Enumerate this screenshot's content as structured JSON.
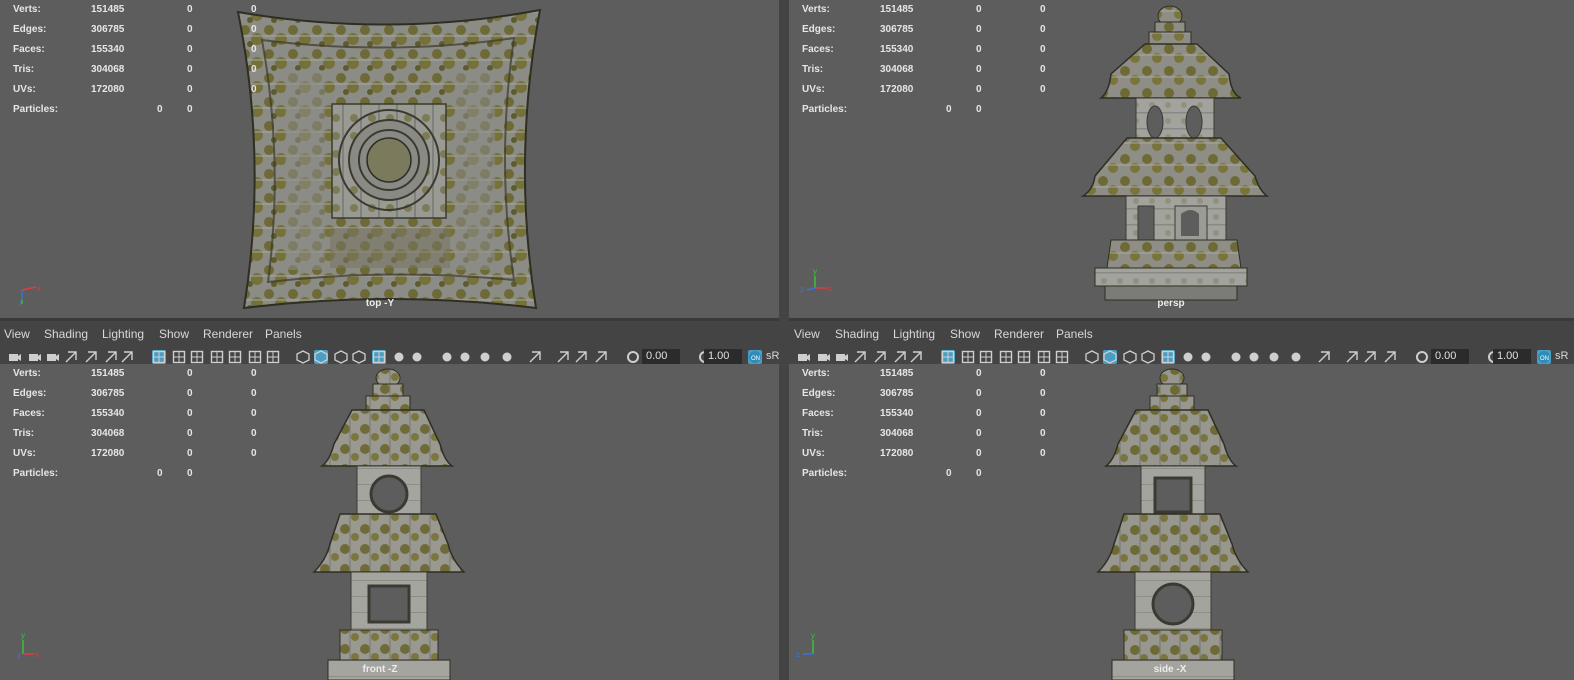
{
  "colors": {
    "viewport_bg": "#5d5d5d",
    "panel_bg": "#444444",
    "hud_text": "#e6e6e6",
    "active_icon": "#4a9ec4",
    "moss": "#7a7436",
    "stone": "#8e8e8a"
  },
  "viewports": {
    "top": {
      "camera": "top -Y",
      "stats": [
        {
          "label": "Verts:",
          "v1": "151485",
          "v2": "0",
          "v3": "0"
        },
        {
          "label": "Edges:",
          "v1": "306785",
          "v2": "0",
          "v3": "0"
        },
        {
          "label": "Faces:",
          "v1": "155340",
          "v2": "0",
          "v3": "0"
        },
        {
          "label": "Tris:",
          "v1": "304068",
          "v2": "0",
          "v3": "0"
        },
        {
          "label": "UVs:",
          "v1": "172080",
          "v2": "0",
          "v3": "0"
        },
        {
          "label": "Particles:",
          "v1": "0",
          "v2": "0"
        }
      ],
      "axis_labels": [
        "y",
        "z",
        "x"
      ]
    },
    "persp": {
      "camera": "persp",
      "stats": [
        {
          "label": "Verts:",
          "v1": "151485",
          "v2": "0",
          "v3": "0"
        },
        {
          "label": "Edges:",
          "v1": "306785",
          "v2": "0",
          "v3": "0"
        },
        {
          "label": "Faces:",
          "v1": "155340",
          "v2": "0",
          "v3": "0"
        },
        {
          "label": "Tris:",
          "v1": "304068",
          "v2": "0",
          "v3": "0"
        },
        {
          "label": "UVs:",
          "v1": "172080",
          "v2": "0",
          "v3": "0"
        },
        {
          "label": "Particles:",
          "v1": "0",
          "v2": "0"
        }
      ],
      "axis_labels": [
        "y",
        "z",
        "x"
      ]
    },
    "front": {
      "camera": "front -Z",
      "stats": [
        {
          "label": "Verts:",
          "v1": "151485",
          "v2": "0",
          "v3": "0"
        },
        {
          "label": "Edges:",
          "v1": "306785",
          "v2": "0",
          "v3": "0"
        },
        {
          "label": "Faces:",
          "v1": "155340",
          "v2": "0",
          "v3": "0"
        },
        {
          "label": "Tris:",
          "v1": "304068",
          "v2": "0",
          "v3": "0"
        },
        {
          "label": "UVs:",
          "v1": "172080",
          "v2": "0",
          "v3": "0"
        },
        {
          "label": "Particles:",
          "v1": "0",
          "v2": "0"
        }
      ],
      "axis_labels": [
        "y",
        "z",
        "x"
      ]
    },
    "side": {
      "camera": "side -X",
      "stats": [
        {
          "label": "Verts:",
          "v1": "151485",
          "v2": "0",
          "v3": "0"
        },
        {
          "label": "Edges:",
          "v1": "306785",
          "v2": "0",
          "v3": "0"
        },
        {
          "label": "Faces:",
          "v1": "155340",
          "v2": "0",
          "v3": "0"
        },
        {
          "label": "Tris:",
          "v1": "304068",
          "v2": "0",
          "v3": "0"
        },
        {
          "label": "UVs:",
          "v1": "172080",
          "v2": "0",
          "v3": "0"
        },
        {
          "label": "Particles:",
          "v1": "0",
          "v2": "0"
        }
      ],
      "axis_labels": [
        "y",
        "z",
        "x"
      ]
    }
  },
  "panel_menu": {
    "view": "View",
    "shading": "Shading",
    "lighting": "Lighting",
    "show": "Show",
    "renderer": "Renderer",
    "panels": "Panels"
  },
  "toolbar": {
    "exposure_value": "0.00",
    "gamma_value": "1.00",
    "colorspace_label": "sR",
    "icons": [
      "camera-icon",
      "select-camera-icon",
      "camera-attributes-icon",
      "bookmark-icon",
      "image-plane-icon",
      "2d-pan-zoom-icon",
      "grease-pencil-icon",
      "grid-icon",
      "film-gate-icon",
      "resolution-gate-icon",
      "gate-mask-icon",
      "field-chart-icon",
      "safe-action-icon",
      "safe-title-icon",
      "wireframe-icon",
      "smooth-shade-icon",
      "default-material-icon",
      "wireframe-on-shaded-icon",
      "textured-icon",
      "use-all-lights-icon",
      "shadows-icon",
      "screen-space-ao-icon",
      "motion-blur-icon",
      "multisample-aa-icon",
      "depth-of-field-icon",
      "isolate-select-icon",
      "xray-icon",
      "xray-active-components-icon",
      "xray-joints-icon",
      "exposure-icon",
      "gamma-icon",
      "color-management-icon"
    ]
  }
}
